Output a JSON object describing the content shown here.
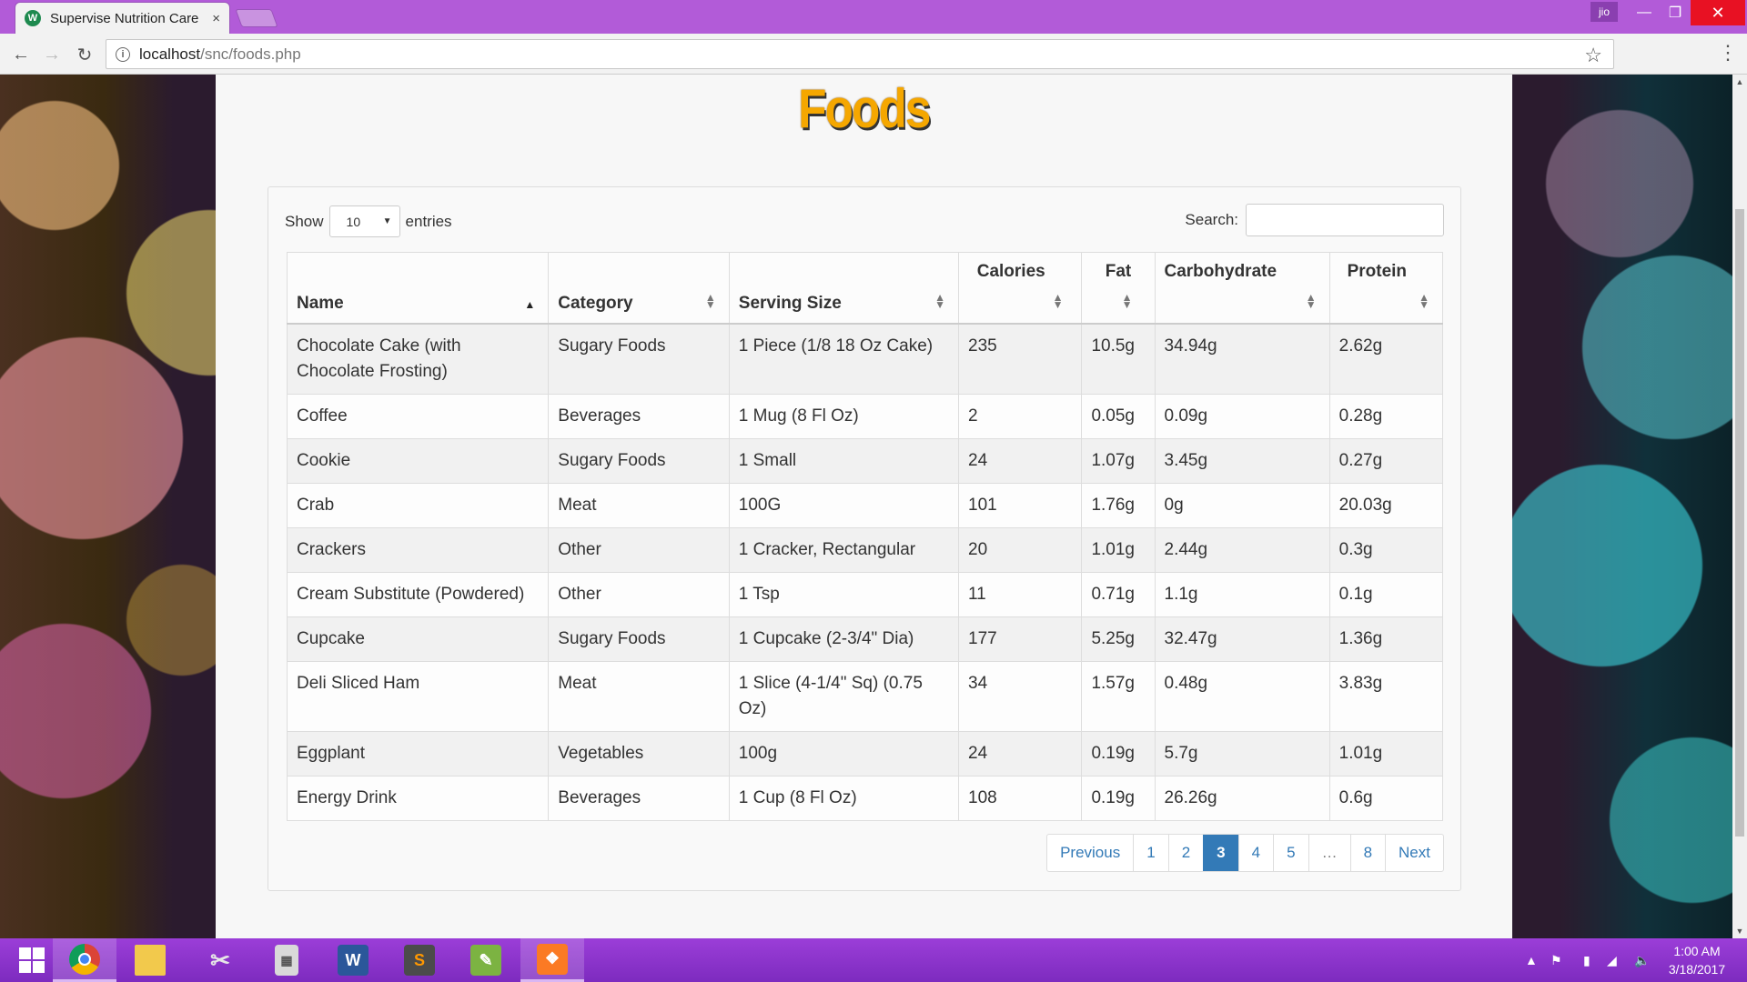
{
  "browser": {
    "tab_title": "Supervise Nutrition Care",
    "tab_close": "×",
    "profile_label": "jio",
    "url_host": "localhost",
    "url_path": "/snc/foods.php"
  },
  "page": {
    "title": "Foods",
    "show_label": "Show",
    "entries_value": "10",
    "entries_label": "entries",
    "search_label": "Search:",
    "search_value": ""
  },
  "table": {
    "columns": [
      "Name",
      "Category",
      "Serving Size",
      "Calories",
      "Fat",
      "Carbohydrate",
      "Protein"
    ],
    "sorted_column": "Name",
    "rows": [
      [
        "Chocolate Cake (with Chocolate Frosting)",
        "Sugary Foods",
        "1 Piece (1/8 18 Oz Cake)",
        "235",
        "10.5g",
        "34.94g",
        "2.62g"
      ],
      [
        "Coffee",
        "Beverages",
        "1 Mug (8 Fl Oz)",
        "2",
        "0.05g",
        "0.09g",
        "0.28g"
      ],
      [
        "Cookie",
        "Sugary Foods",
        "1 Small",
        "24",
        "1.07g",
        "3.45g",
        "0.27g"
      ],
      [
        "Crab",
        "Meat",
        "100G",
        "101",
        "1.76g",
        "0g",
        "20.03g"
      ],
      [
        "Crackers",
        "Other",
        "1 Cracker, Rectangular",
        "20",
        "1.01g",
        "2.44g",
        "0.3g"
      ],
      [
        "Cream Substitute (Powdered)",
        "Other",
        "1 Tsp",
        "11",
        "0.71g",
        "1.1g",
        "0.1g"
      ],
      [
        "Cupcake",
        "Sugary Foods",
        "1 Cupcake (2-3/4\" Dia)",
        "177",
        "5.25g",
        "32.47g",
        "1.36g"
      ],
      [
        "Deli Sliced Ham",
        "Meat",
        "1 Slice (4-1/4\" Sq) (0.75 Oz)",
        "34",
        "1.57g",
        "0.48g",
        "3.83g"
      ],
      [
        "Eggplant",
        "Vegetables",
        "100g",
        "24",
        "0.19g",
        "5.7g",
        "1.01g"
      ],
      [
        "Energy Drink",
        "Beverages",
        "1 Cup (8 Fl Oz)",
        "108",
        "0.19g",
        "26.26g",
        "0.6g"
      ]
    ]
  },
  "pagination": {
    "previous": "Previous",
    "pages": [
      "1",
      "2",
      "3",
      "4",
      "5",
      "…",
      "8"
    ],
    "active_page": "3",
    "next": "Next"
  },
  "taskbar": {
    "apps": [
      "start",
      "chrome",
      "file-explorer",
      "snipping-tool",
      "calculator",
      "word",
      "sublime-text",
      "notepad",
      "xampp"
    ],
    "time": "1:00 AM",
    "date": "3/18/2017"
  },
  "colors": {
    "titlebar": "#b25bd8",
    "title_text": "#f5a700",
    "link": "#337ab7",
    "taskbar": "#8a35cc"
  }
}
